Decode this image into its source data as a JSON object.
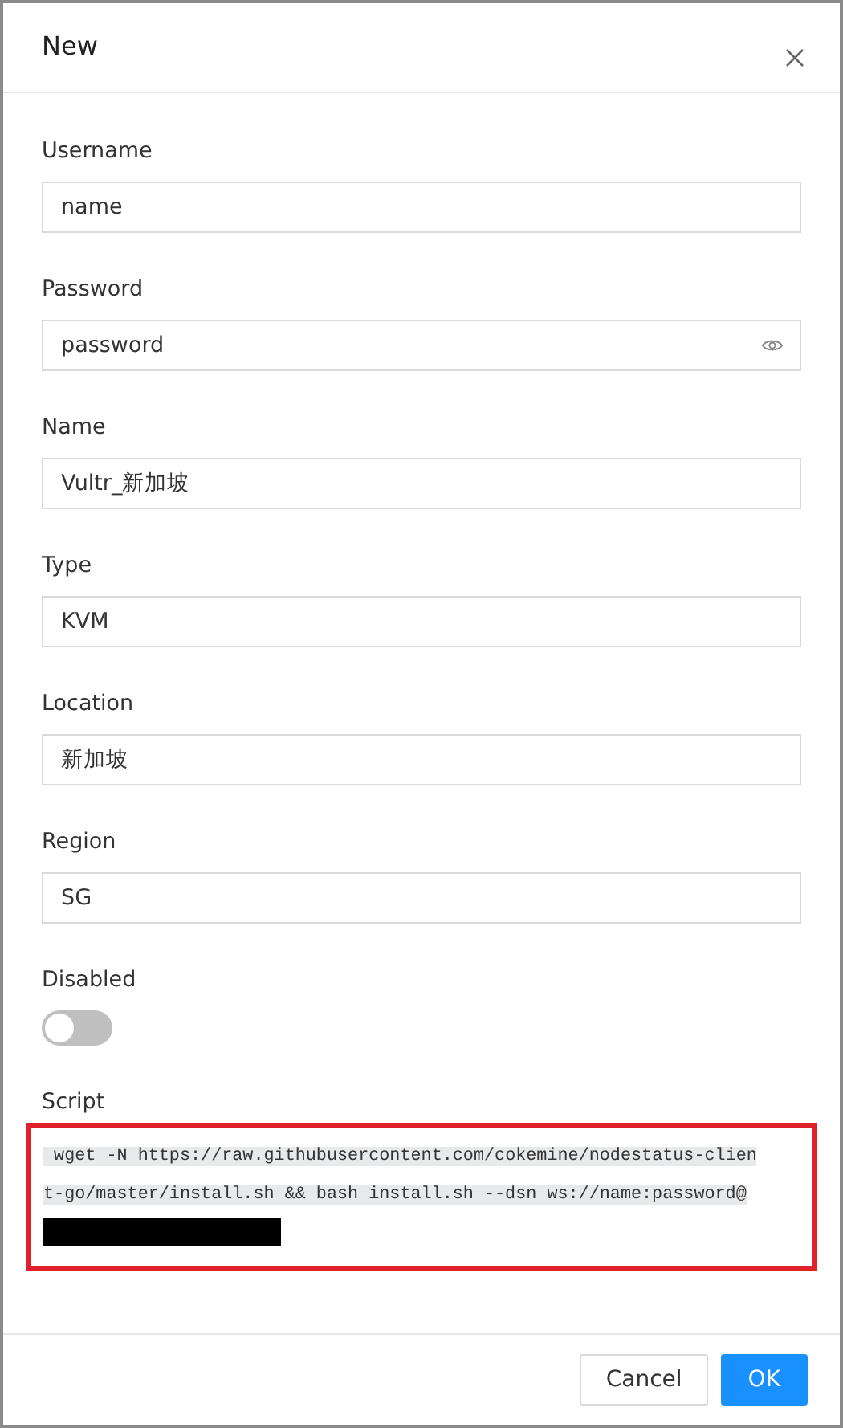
{
  "dialog": {
    "title": "New"
  },
  "fields": [
    {
      "kind": "text",
      "label": "Username",
      "value": "name"
    },
    {
      "kind": "password",
      "label": "Password",
      "value": "password"
    },
    {
      "kind": "text",
      "label": "Name",
      "value": "Vultr_新加坡"
    },
    {
      "kind": "text",
      "label": "Type",
      "value": "KVM"
    },
    {
      "kind": "text",
      "label": "Location",
      "value": "新加坡"
    },
    {
      "kind": "text",
      "label": "Region",
      "value": "SG"
    },
    {
      "kind": "switch",
      "label": "Disabled",
      "on": false
    }
  ],
  "script": {
    "label": "Script",
    "value": " wget -N https://raw.githubusercontent.com/cokemine/nodestatus-client-go/master/install.sh && bash install.sh --dsn ws://name:password@",
    "redacted": true,
    "highlighted": true
  },
  "buttons": [
    {
      "kind": "secondary",
      "label": "Cancel"
    },
    {
      "kind": "primary",
      "label": "OK"
    }
  ]
}
